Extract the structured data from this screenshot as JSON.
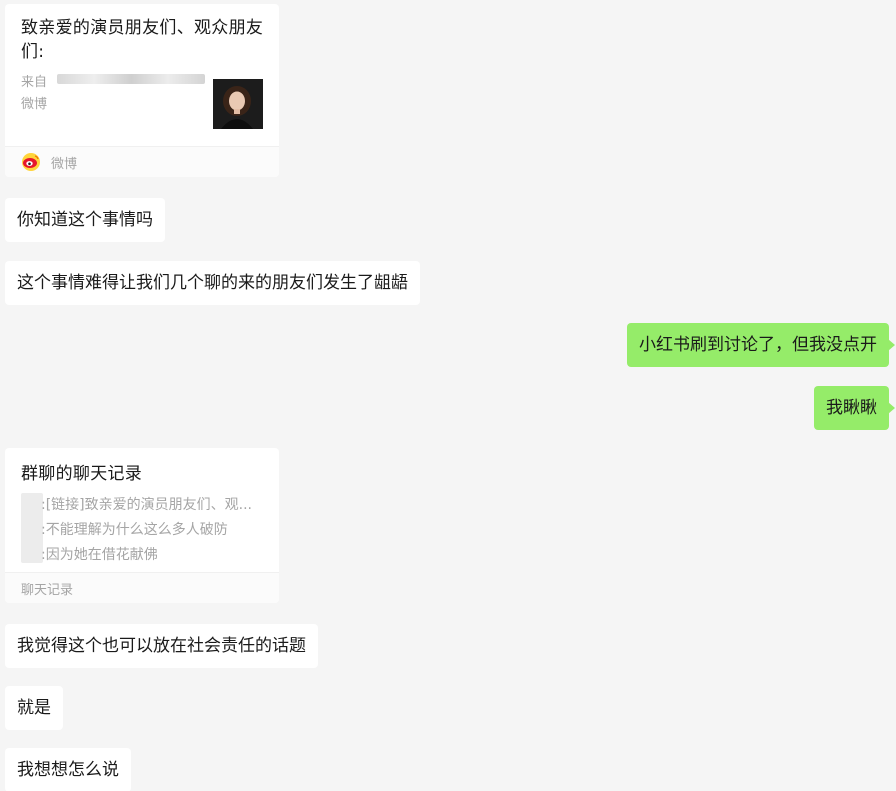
{
  "weibo_card": {
    "title": "致亲爱的演员朋友们、观众朋友们:",
    "source_line1": "来自",
    "source_line2": "微博",
    "footer_label": "微博",
    "footer_icon": "weibo-icon"
  },
  "messages_before": [
    "你知道这个事情吗",
    "这个事情难得让我们几个聊的来的朋友们发生了龃龉"
  ],
  "messages_out": [
    "小红书刷到讨论了，但我没点开",
    "我瞅瞅"
  ],
  "history_card": {
    "title": "群聊的聊天记录",
    "lines": [
      ":[链接]致亲爱的演员朋友们、观...",
      ":不能理解为什么这么多人破防",
      ":因为她在借花献佛"
    ],
    "footer_label": "聊天记录"
  },
  "messages_after": [
    "我觉得这个也可以放在社会责任的话题",
    "就是",
    "我想想怎么说"
  ],
  "colors": {
    "background": "#f5f5f5",
    "incoming_bubble": "#ffffff",
    "outgoing_bubble": "#95ec69"
  }
}
